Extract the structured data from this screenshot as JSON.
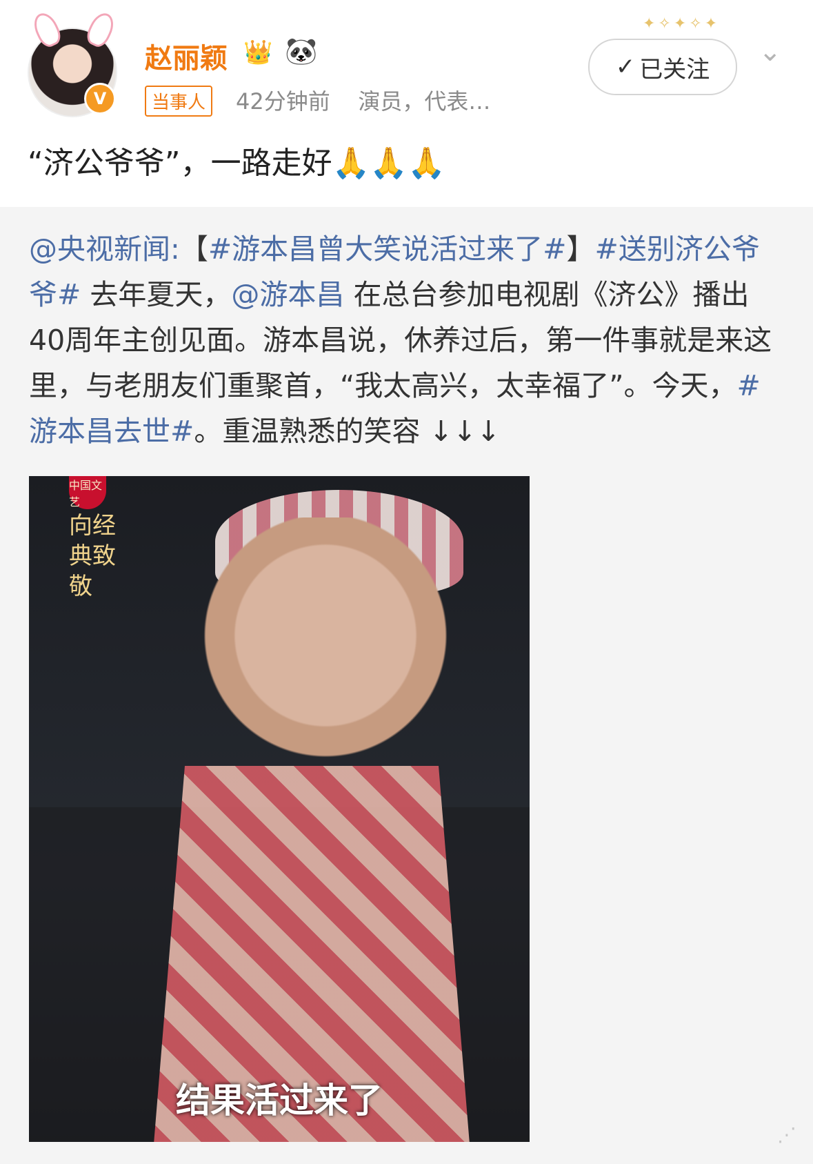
{
  "header": {
    "username": "赵丽颖",
    "badge_crown": "👑",
    "badge_panda": "🐼",
    "tag": "当事人",
    "time": "42分钟前",
    "description": "演员，代表…",
    "follow_label": "已关注",
    "verified_label": "V"
  },
  "post": {
    "text": "“济公爷爷”，一路走好🙏🙏🙏"
  },
  "repost": {
    "segments": [
      {
        "text": "@央视新闻:",
        "type": "link"
      },
      {
        "text": "【",
        "type": "text"
      },
      {
        "text": "#游本昌曾大笑说活过来了#",
        "type": "link"
      },
      {
        "text": "】",
        "type": "text"
      },
      {
        "text": "#送别济公爷爷#",
        "type": "link"
      },
      {
        "text": " 去年夏天，",
        "type": "text"
      },
      {
        "text": "@游本昌",
        "type": "link"
      },
      {
        "text": " 在总台参加电视剧《济公》播出40周年主创见面。游本昌说，休养过后，第一件事就是来这里，与老朋友们重聚首，“我太高兴，太幸福了”。今天，",
        "type": "text"
      },
      {
        "text": "#游本昌去世#",
        "type": "link"
      },
      {
        "text": "。重温熟悉的笑容 ↓↓↓",
        "type": "text"
      }
    ],
    "image": {
      "caption": "结果活过来了",
      "logo_text": "中国文艺",
      "calligraphy": "向经典致敬"
    }
  },
  "colors": {
    "accent": "#f07a12",
    "link": "#4c6da6",
    "repost_bg": "#f4f4f4"
  }
}
